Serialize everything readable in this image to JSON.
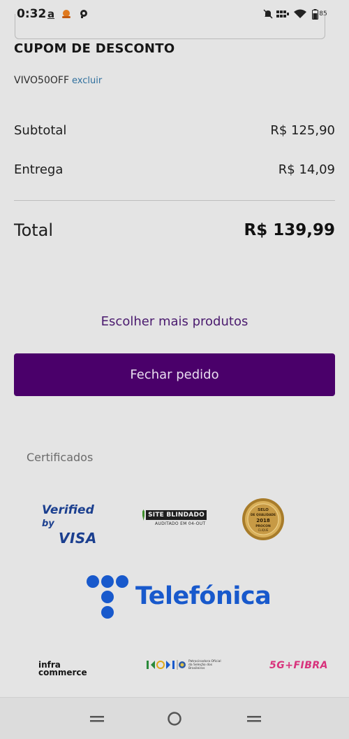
{
  "status_bar": {
    "time": "0:32",
    "battery": "85",
    "icons": [
      "amazon-icon",
      "food-icon",
      "chat-icon",
      "mute-icon",
      "signal-icon",
      "wifi-icon",
      "battery-icon"
    ]
  },
  "coupon": {
    "title": "CUPOM DE DESCONTO",
    "code": "VIVO50OFF",
    "remove_label": "excluir"
  },
  "summary": {
    "subtotal_label": "Subtotal",
    "subtotal_value": "R$ 125,90",
    "delivery_label": "Entrega",
    "delivery_value": "R$ 14,09",
    "total_label": "Total",
    "total_value": "R$ 139,99"
  },
  "actions": {
    "more_products": "Escolher mais produtos",
    "checkout": "Fechar pedido"
  },
  "certificates": {
    "label": "Certificados",
    "visa_line1": "Verified",
    "visa_by": "by",
    "visa_line2": "VISA",
    "blindado_title": "SITE BLINDADO",
    "blindado_sub": "AUDITADO EM 04-OUT",
    "seal_line1": "SELO",
    "seal_line2": "DE QUALIDADE",
    "seal_year": "2018",
    "seal_line3": "PROCON",
    "seal_line4": "CLIQUE"
  },
  "partners": {
    "telefonica": "Telefónica",
    "infra_line1": "infra",
    "infra_line2": "commerce",
    "koi_text": "Patrocinadora Oficial da Seleção dos Brasileiros",
    "fibra": "5G+FIBRA"
  },
  "colors": {
    "accent_purple": "#4a006a",
    "link_purple": "#4a1a6e",
    "telefonica_blue": "#1859cc",
    "fibra_pink": "#d8327c"
  }
}
